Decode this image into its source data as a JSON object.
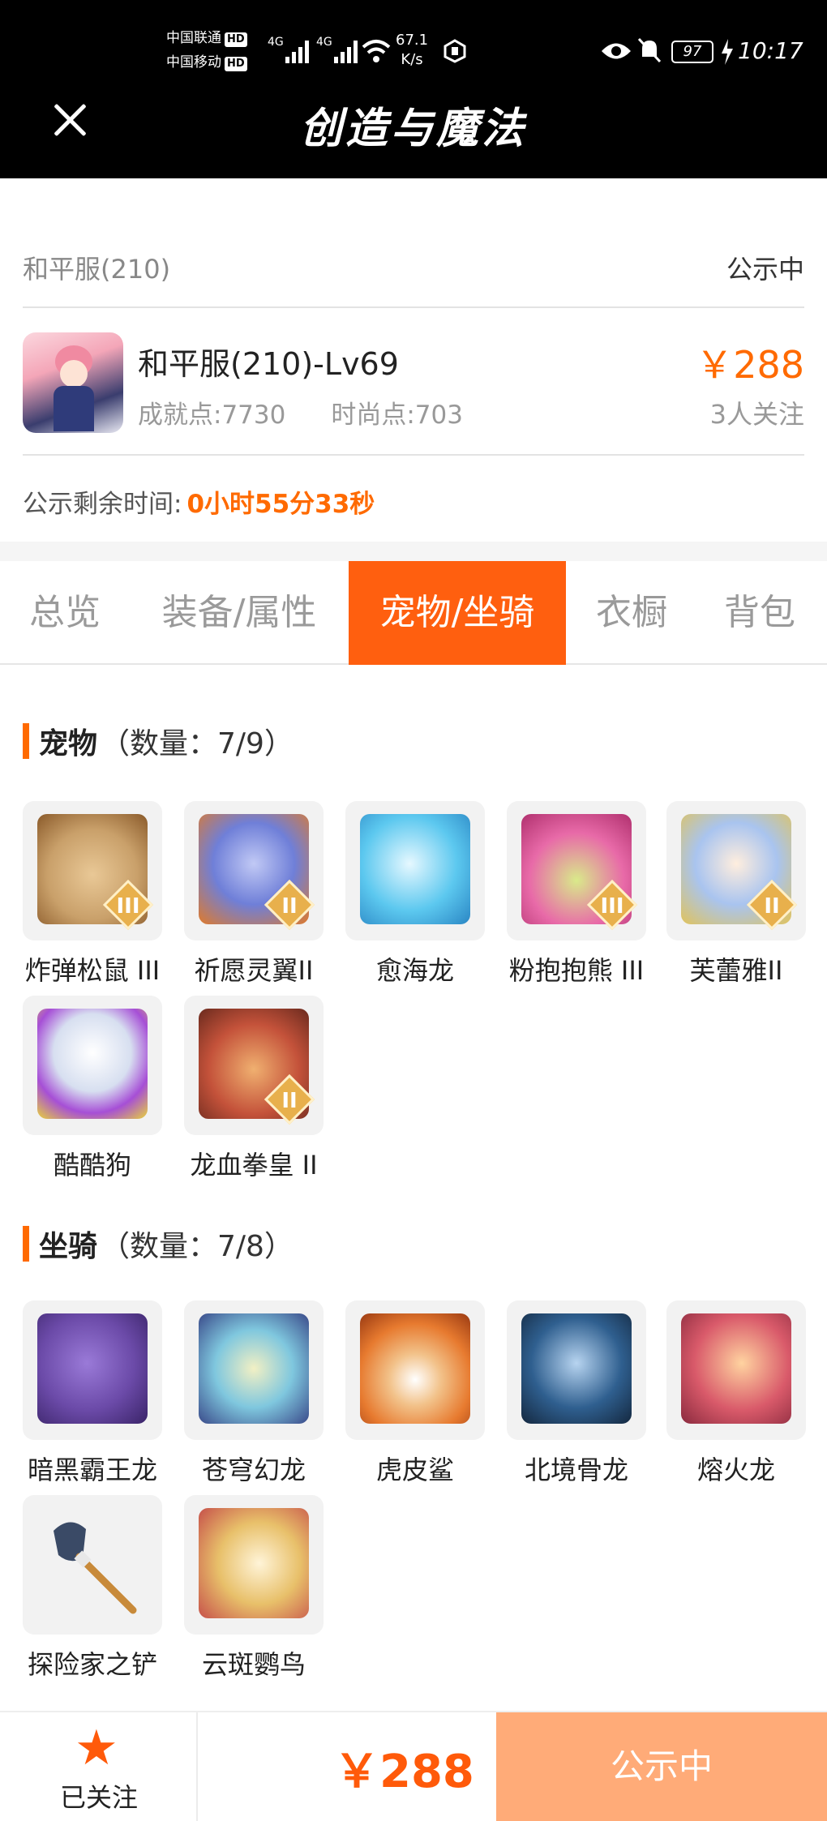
{
  "status_bar": {
    "carrier1": "中国联通",
    "carrier2": "中国移动",
    "hd": "HD",
    "sig1": "4G",
    "sig2": "4G",
    "speed": "67.1",
    "speed_unit": "K/s",
    "battery": "97",
    "time": "10:17"
  },
  "header": {
    "title": "创造与魔法",
    "close_icon": "close-icon"
  },
  "listing": {
    "server": "和平服(210)",
    "status": "公示中",
    "character": "和平服(210)-Lv69",
    "achievement": "成就点:7730",
    "fashion": "时尚点:703",
    "price": "￥288",
    "followers": "3人关注",
    "remain_label": "公示剩余时间:",
    "remain_value": "0小时55分33秒"
  },
  "tabs": [
    "总览",
    "装备/属性",
    "宠物/坐骑",
    "衣橱",
    "背包"
  ],
  "active_tab": 2,
  "pets": {
    "title": "宠物",
    "count": "（数量：7/9）",
    "items": [
      {
        "label": "炸弹松鼠 III",
        "rank": "III",
        "color": "#c9a06a"
      },
      {
        "label": "祈愿灵翼II",
        "rank": "II",
        "color": "#6f7fd8"
      },
      {
        "label": "愈海龙",
        "rank": "",
        "color": "#5cc8ef"
      },
      {
        "label": "粉抱抱熊 III",
        "rank": "III",
        "color": "#e86aa8"
      },
      {
        "label": "芙蕾雅II",
        "rank": "II",
        "color": "#a9c4ef"
      },
      {
        "label": "酷酷狗",
        "rank": "",
        "color": "#d7dff0"
      },
      {
        "label": "龙血拳皇 II",
        "rank": "II",
        "color": "#c4523a"
      }
    ]
  },
  "mounts": {
    "title": "坐骑",
    "count": "（数量：7/8）",
    "items": [
      {
        "label": "暗黑霸王龙",
        "color": "#6b4aa8"
      },
      {
        "label": "苍穹幻龙",
        "color": "#7fc7de"
      },
      {
        "label": "虎皮鲨",
        "color": "#e77a2f"
      },
      {
        "label": "北境骨龙",
        "color": "#2f5f8f"
      },
      {
        "label": "熔火龙",
        "color": "#d95a6a"
      },
      {
        "label": "探险家之铲",
        "color": "#3a4a66"
      },
      {
        "label": "云斑鹦鸟",
        "color": "#e8c06a"
      }
    ]
  },
  "bottom": {
    "follow_label": "已关注",
    "price": "￥288",
    "status_button": "公示中"
  }
}
